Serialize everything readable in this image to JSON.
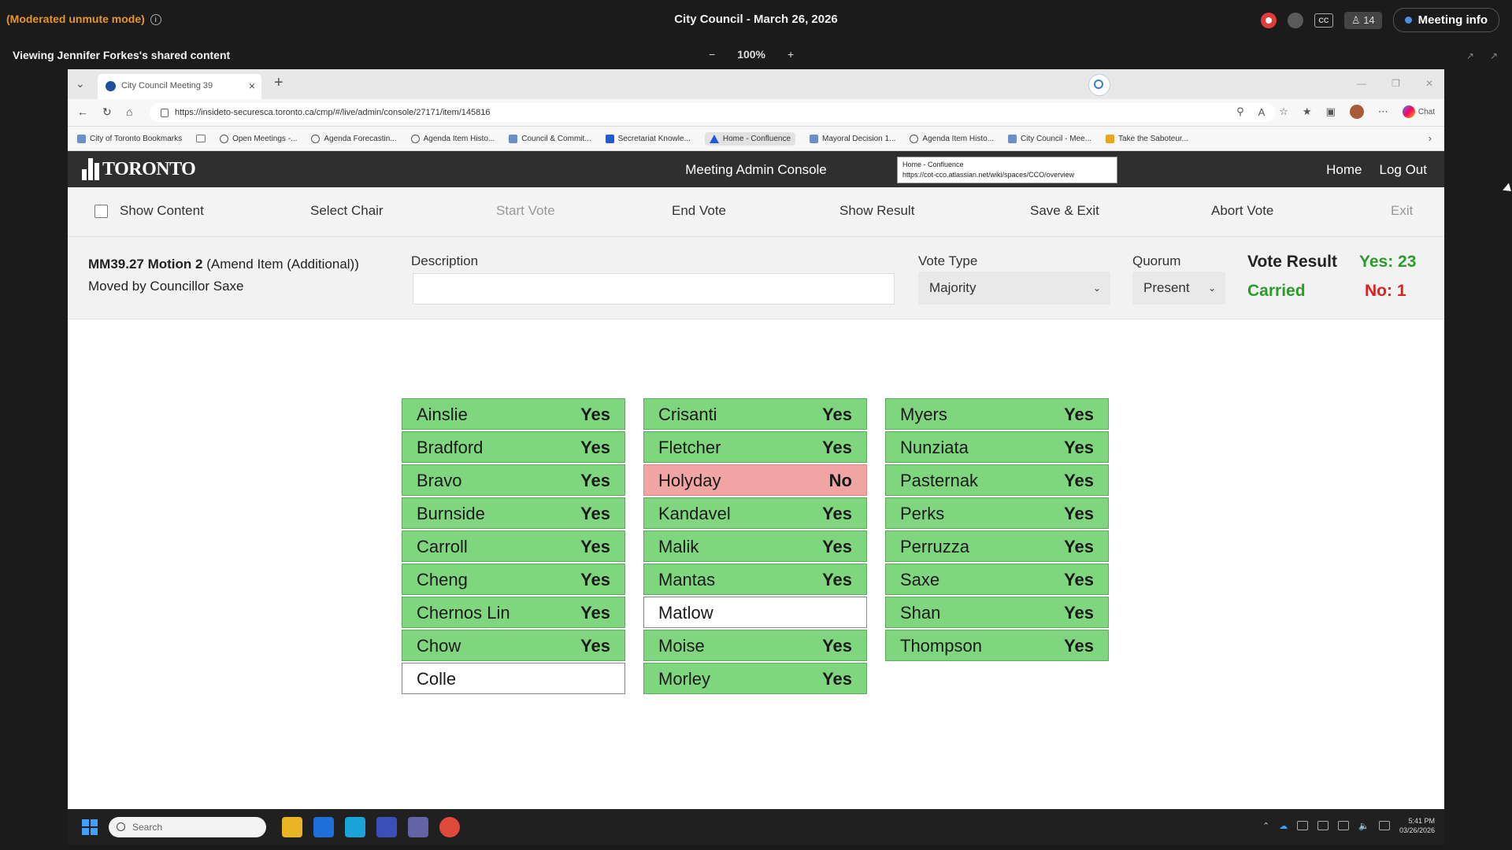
{
  "meeting_bar": {
    "mode": "(Moderated unmute mode)",
    "title": "City Council - March 26, 2026",
    "participants": "14",
    "cc": "CC",
    "meeting_info": "Meeting info",
    "share_text": "Viewing Jennifer Forkes's shared content",
    "zoom_minus": "−",
    "zoom": "100%",
    "zoom_plus": "+"
  },
  "browser": {
    "tab_title": "City Council   Meeting 39",
    "url": "https://insideto-securesca.toronto.ca/cmp/#/live/admin/console/27171/item/145816",
    "copilot": "Chat",
    "bookmarks": [
      "City of Toronto Bookmarks",
      "Open Meetings -...",
      "Agenda Forecastin...",
      "Agenda Item Histo...",
      "Council & Commit...",
      "Secretariat Knowle...",
      "Home - Confluence",
      "Mayoral Decision 1...",
      "Agenda Item Histo...",
      "City Council - Mee...",
      "Take the Saboteur..."
    ]
  },
  "app": {
    "logo": "TORONTO",
    "title": "Meeting Admin Console",
    "tooltip_line1": "Home - Confluence",
    "tooltip_line2": "https://cot-cco.atlassian.net/wiki/spaces/CCO/overview",
    "nav": {
      "home": "Home",
      "logout": "Log Out"
    }
  },
  "toolbar": {
    "show_content": "Show Content",
    "select_chair": "Select Chair",
    "start_vote": "Start Vote",
    "end_vote": "End Vote",
    "show_result": "Show Result",
    "save_exit": "Save & Exit",
    "abort_vote": "Abort Vote",
    "exit": "Exit"
  },
  "item": {
    "code": "MM39.27 Motion 2",
    "type": " (Amend Item (Additional))",
    "moved_by": "Moved by Councillor Saxe",
    "description_label": "Description",
    "description_value": "",
    "vote_type_label": "Vote Type",
    "vote_type": "Majority",
    "quorum_label": "Quorum",
    "quorum": "Present",
    "vote_result_label": "Vote Result",
    "result": "Carried",
    "yes": "Yes: 23",
    "no": "No: 1"
  },
  "votes": [
    [
      {
        "name": "Ainslie",
        "vote": "Yes"
      },
      {
        "name": "Bradford",
        "vote": "Yes"
      },
      {
        "name": "Bravo",
        "vote": "Yes"
      },
      {
        "name": "Burnside",
        "vote": "Yes"
      },
      {
        "name": "Carroll",
        "vote": "Yes"
      },
      {
        "name": "Cheng",
        "vote": "Yes"
      },
      {
        "name": "Chernos Lin",
        "vote": "Yes"
      },
      {
        "name": "Chow",
        "vote": "Yes"
      },
      {
        "name": "Colle",
        "vote": ""
      }
    ],
    [
      {
        "name": "Crisanti",
        "vote": "Yes"
      },
      {
        "name": "Fletcher",
        "vote": "Yes"
      },
      {
        "name": "Holyday",
        "vote": "No"
      },
      {
        "name": "Kandavel",
        "vote": "Yes"
      },
      {
        "name": "Malik",
        "vote": "Yes"
      },
      {
        "name": "Mantas",
        "vote": "Yes"
      },
      {
        "name": "Matlow",
        "vote": ""
      },
      {
        "name": "Moise",
        "vote": "Yes"
      },
      {
        "name": "Morley",
        "vote": "Yes"
      }
    ],
    [
      {
        "name": "Myers",
        "vote": "Yes"
      },
      {
        "name": "Nunziata",
        "vote": "Yes"
      },
      {
        "name": "Pasternak",
        "vote": "Yes"
      },
      {
        "name": "Perks",
        "vote": "Yes"
      },
      {
        "name": "Perruzza",
        "vote": "Yes"
      },
      {
        "name": "Saxe",
        "vote": "Yes"
      },
      {
        "name": "Shan",
        "vote": "Yes"
      },
      {
        "name": "Thompson",
        "vote": "Yes"
      }
    ]
  ],
  "taskbar": {
    "search": "Search",
    "time": "5:41 PM",
    "date": "03/26/2026"
  },
  "colors": {
    "yes": "#7fd67f",
    "no": "#f0a4a4",
    "none": "#ffffff",
    "carried": "#2e9a2e",
    "no_count": "#e02020"
  }
}
